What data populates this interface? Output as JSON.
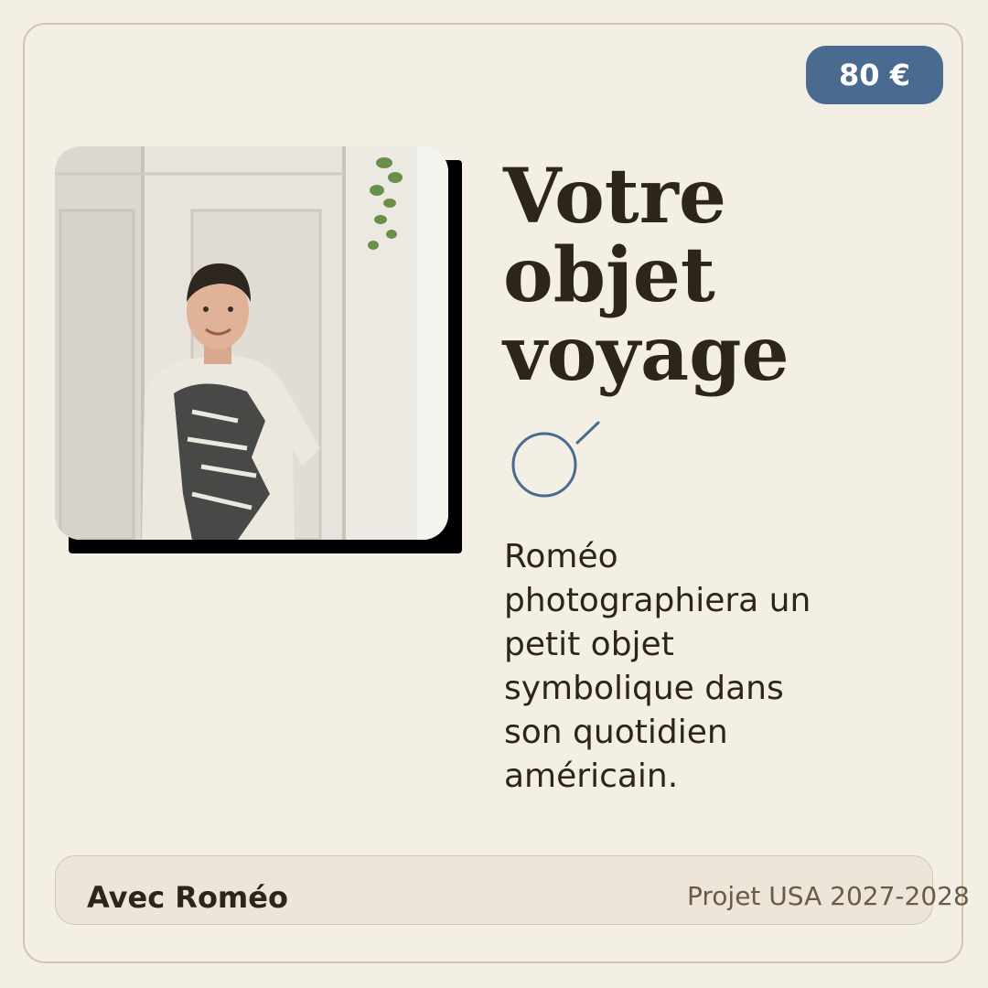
{
  "price": "80 €",
  "title_lines": [
    "Votre",
    "objet",
    "voyage"
  ],
  "description_lines": [
    "Roméo",
    "photographiera un",
    "petit objet",
    "symbolique dans",
    "son quotidien",
    "américain."
  ],
  "footer": {
    "with_label": "Avec Roméo",
    "project_label": "Projet USA 2027-2028"
  },
  "icon": "magnifier-lens-icon",
  "colors": {
    "accent": "#4a6b8f",
    "background": "#f3efe4",
    "text": "#2d241b",
    "border": "#d3c6ad",
    "muted_text": "#6b5a49"
  }
}
